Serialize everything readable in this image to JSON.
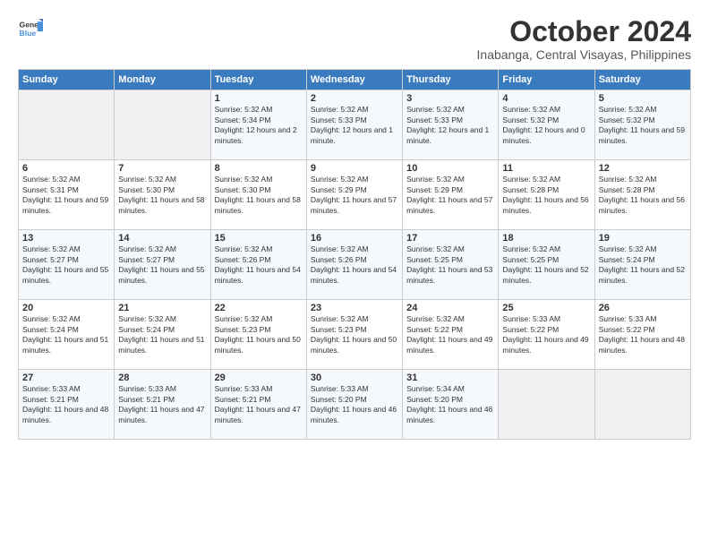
{
  "header": {
    "title": "October 2024",
    "subtitle": "Inabanga, Central Visayas, Philippines"
  },
  "days_of_week": [
    "Sunday",
    "Monday",
    "Tuesday",
    "Wednesday",
    "Thursday",
    "Friday",
    "Saturday"
  ],
  "weeks": [
    [
      {
        "day": "",
        "sunrise": "",
        "sunset": "",
        "daylight": ""
      },
      {
        "day": "",
        "sunrise": "",
        "sunset": "",
        "daylight": ""
      },
      {
        "day": "1",
        "sunrise": "Sunrise: 5:32 AM",
        "sunset": "Sunset: 5:34 PM",
        "daylight": "Daylight: 12 hours and 2 minutes."
      },
      {
        "day": "2",
        "sunrise": "Sunrise: 5:32 AM",
        "sunset": "Sunset: 5:33 PM",
        "daylight": "Daylight: 12 hours and 1 minute."
      },
      {
        "day": "3",
        "sunrise": "Sunrise: 5:32 AM",
        "sunset": "Sunset: 5:33 PM",
        "daylight": "Daylight: 12 hours and 1 minute."
      },
      {
        "day": "4",
        "sunrise": "Sunrise: 5:32 AM",
        "sunset": "Sunset: 5:32 PM",
        "daylight": "Daylight: 12 hours and 0 minutes."
      },
      {
        "day": "5",
        "sunrise": "Sunrise: 5:32 AM",
        "sunset": "Sunset: 5:32 PM",
        "daylight": "Daylight: 11 hours and 59 minutes."
      }
    ],
    [
      {
        "day": "6",
        "sunrise": "Sunrise: 5:32 AM",
        "sunset": "Sunset: 5:31 PM",
        "daylight": "Daylight: 11 hours and 59 minutes."
      },
      {
        "day": "7",
        "sunrise": "Sunrise: 5:32 AM",
        "sunset": "Sunset: 5:30 PM",
        "daylight": "Daylight: 11 hours and 58 minutes."
      },
      {
        "day": "8",
        "sunrise": "Sunrise: 5:32 AM",
        "sunset": "Sunset: 5:30 PM",
        "daylight": "Daylight: 11 hours and 58 minutes."
      },
      {
        "day": "9",
        "sunrise": "Sunrise: 5:32 AM",
        "sunset": "Sunset: 5:29 PM",
        "daylight": "Daylight: 11 hours and 57 minutes."
      },
      {
        "day": "10",
        "sunrise": "Sunrise: 5:32 AM",
        "sunset": "Sunset: 5:29 PM",
        "daylight": "Daylight: 11 hours and 57 minutes."
      },
      {
        "day": "11",
        "sunrise": "Sunrise: 5:32 AM",
        "sunset": "Sunset: 5:28 PM",
        "daylight": "Daylight: 11 hours and 56 minutes."
      },
      {
        "day": "12",
        "sunrise": "Sunrise: 5:32 AM",
        "sunset": "Sunset: 5:28 PM",
        "daylight": "Daylight: 11 hours and 56 minutes."
      }
    ],
    [
      {
        "day": "13",
        "sunrise": "Sunrise: 5:32 AM",
        "sunset": "Sunset: 5:27 PM",
        "daylight": "Daylight: 11 hours and 55 minutes."
      },
      {
        "day": "14",
        "sunrise": "Sunrise: 5:32 AM",
        "sunset": "Sunset: 5:27 PM",
        "daylight": "Daylight: 11 hours and 55 minutes."
      },
      {
        "day": "15",
        "sunrise": "Sunrise: 5:32 AM",
        "sunset": "Sunset: 5:26 PM",
        "daylight": "Daylight: 11 hours and 54 minutes."
      },
      {
        "day": "16",
        "sunrise": "Sunrise: 5:32 AM",
        "sunset": "Sunset: 5:26 PM",
        "daylight": "Daylight: 11 hours and 54 minutes."
      },
      {
        "day": "17",
        "sunrise": "Sunrise: 5:32 AM",
        "sunset": "Sunset: 5:25 PM",
        "daylight": "Daylight: 11 hours and 53 minutes."
      },
      {
        "day": "18",
        "sunrise": "Sunrise: 5:32 AM",
        "sunset": "Sunset: 5:25 PM",
        "daylight": "Daylight: 11 hours and 52 minutes."
      },
      {
        "day": "19",
        "sunrise": "Sunrise: 5:32 AM",
        "sunset": "Sunset: 5:24 PM",
        "daylight": "Daylight: 11 hours and 52 minutes."
      }
    ],
    [
      {
        "day": "20",
        "sunrise": "Sunrise: 5:32 AM",
        "sunset": "Sunset: 5:24 PM",
        "daylight": "Daylight: 11 hours and 51 minutes."
      },
      {
        "day": "21",
        "sunrise": "Sunrise: 5:32 AM",
        "sunset": "Sunset: 5:24 PM",
        "daylight": "Daylight: 11 hours and 51 minutes."
      },
      {
        "day": "22",
        "sunrise": "Sunrise: 5:32 AM",
        "sunset": "Sunset: 5:23 PM",
        "daylight": "Daylight: 11 hours and 50 minutes."
      },
      {
        "day": "23",
        "sunrise": "Sunrise: 5:32 AM",
        "sunset": "Sunset: 5:23 PM",
        "daylight": "Daylight: 11 hours and 50 minutes."
      },
      {
        "day": "24",
        "sunrise": "Sunrise: 5:32 AM",
        "sunset": "Sunset: 5:22 PM",
        "daylight": "Daylight: 11 hours and 49 minutes."
      },
      {
        "day": "25",
        "sunrise": "Sunrise: 5:33 AM",
        "sunset": "Sunset: 5:22 PM",
        "daylight": "Daylight: 11 hours and 49 minutes."
      },
      {
        "day": "26",
        "sunrise": "Sunrise: 5:33 AM",
        "sunset": "Sunset: 5:22 PM",
        "daylight": "Daylight: 11 hours and 48 minutes."
      }
    ],
    [
      {
        "day": "27",
        "sunrise": "Sunrise: 5:33 AM",
        "sunset": "Sunset: 5:21 PM",
        "daylight": "Daylight: 11 hours and 48 minutes."
      },
      {
        "day": "28",
        "sunrise": "Sunrise: 5:33 AM",
        "sunset": "Sunset: 5:21 PM",
        "daylight": "Daylight: 11 hours and 47 minutes."
      },
      {
        "day": "29",
        "sunrise": "Sunrise: 5:33 AM",
        "sunset": "Sunset: 5:21 PM",
        "daylight": "Daylight: 11 hours and 47 minutes."
      },
      {
        "day": "30",
        "sunrise": "Sunrise: 5:33 AM",
        "sunset": "Sunset: 5:20 PM",
        "daylight": "Daylight: 11 hours and 46 minutes."
      },
      {
        "day": "31",
        "sunrise": "Sunrise: 5:34 AM",
        "sunset": "Sunset: 5:20 PM",
        "daylight": "Daylight: 11 hours and 46 minutes."
      },
      {
        "day": "",
        "sunrise": "",
        "sunset": "",
        "daylight": ""
      },
      {
        "day": "",
        "sunrise": "",
        "sunset": "",
        "daylight": ""
      }
    ]
  ]
}
